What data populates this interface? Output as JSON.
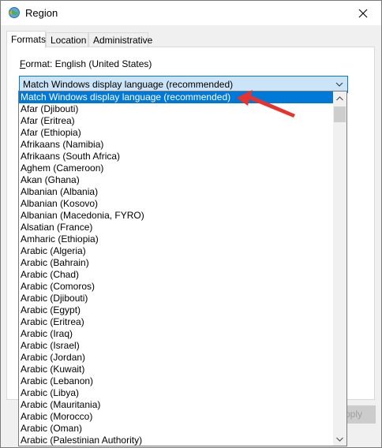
{
  "window": {
    "title": "Region"
  },
  "tabs": [
    {
      "label": "Formats"
    },
    {
      "label": "Location"
    },
    {
      "label": "Administrative"
    }
  ],
  "format": {
    "label_accel": "F",
    "label_rest": "ormat: English (United States)",
    "selected_value": "Match Windows display language (recommended)"
  },
  "buttons": {
    "apply": "Apply"
  },
  "dropdown": {
    "items": [
      "Match Windows display language (recommended)",
      "Afar (Djibouti)",
      "Afar (Eritrea)",
      "Afar (Ethiopia)",
      "Afrikaans (Namibia)",
      "Afrikaans (South Africa)",
      "Aghem (Cameroon)",
      "Akan (Ghana)",
      "Albanian (Albania)",
      "Albanian (Kosovo)",
      "Albanian (Macedonia, FYRO)",
      "Alsatian (France)",
      "Amharic (Ethiopia)",
      "Arabic (Algeria)",
      "Arabic (Bahrain)",
      "Arabic (Chad)",
      "Arabic (Comoros)",
      "Arabic (Djibouti)",
      "Arabic (Egypt)",
      "Arabic (Eritrea)",
      "Arabic (Iraq)",
      "Arabic (Israel)",
      "Arabic (Jordan)",
      "Arabic (Kuwait)",
      "Arabic (Lebanon)",
      "Arabic (Libya)",
      "Arabic (Mauritania)",
      "Arabic (Morocco)",
      "Arabic (Oman)",
      "Arabic (Palestinian Authority)"
    ]
  },
  "colors": {
    "selection": "#0078d7",
    "combo_bg": "#cce4f7",
    "annotation_arrow": "#e8322d"
  },
  "icons": {
    "app": "region-globe-icon",
    "close": "close-icon",
    "combo": "chevron-down-icon",
    "scroll_up": "scroll-up-arrow-icon",
    "scroll_down": "scroll-down-arrow-icon"
  }
}
